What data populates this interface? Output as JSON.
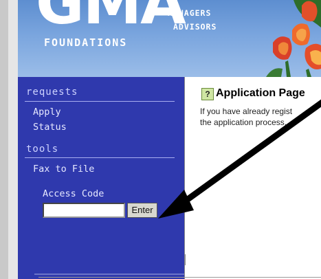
{
  "header": {
    "logo_main": "GMA",
    "logo_sub": "FOUNDATIONS",
    "tagline_line1": "MANAGERS",
    "tagline_line2": "ADVISORS"
  },
  "sidebar": {
    "section_requests": "requests",
    "apply": "Apply",
    "status": "Status",
    "section_tools": "tools",
    "fax_to_file": "Fax to File",
    "access_code_label": "Access Code",
    "access_code_value": "",
    "enter_button": "Enter"
  },
  "content": {
    "help_icon_glyph": "?",
    "title": "Application Page",
    "body_line1": "If you have already regist",
    "body_line2": "the application process."
  },
  "colors": {
    "sidebar_bg": "#2f39ad",
    "header_bg": "#7aa5de",
    "arrow": "#000000"
  },
  "icons": {
    "help": "question-mark-icon",
    "annotation": "pointer-arrow"
  }
}
